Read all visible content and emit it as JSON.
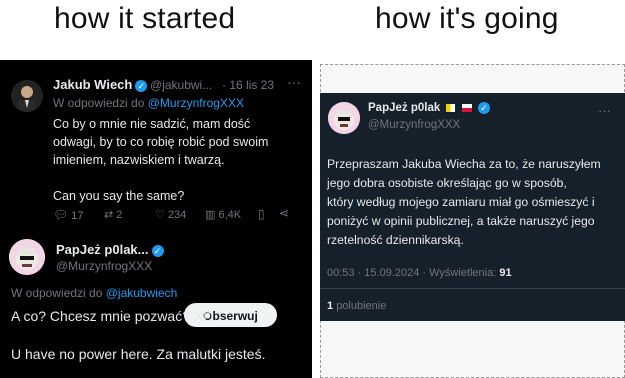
{
  "captions": {
    "left": "how it started",
    "right": "how it's going"
  },
  "left": {
    "tweet1": {
      "name": "Jakub Wiech",
      "handle": "@jakubwi...",
      "date": "· 16 lis 23",
      "more": "···",
      "reply_prefix": "W odpowiedzi do",
      "reply_to": "@MurzynfrogXXX",
      "text_lines": [
        "Co by o mnie nie sadzić, mam dość",
        "odwagi, by to co robię robić pod swoim",
        "imieniem, nazwiskiem i twarzą.",
        "",
        "Can you say the same?"
      ],
      "actions": {
        "replies": "17",
        "retweets": "2",
        "likes": "234",
        "views": "6,4K"
      }
    },
    "tweet2": {
      "name": "PapJeż p0lak...",
      "handle": "@MurzynfrogXXX",
      "follow_label": "Obserwuj",
      "reply_prefix": "W odpowiedzi do",
      "reply_to": "@jakubwiech",
      "line1": "A co? Chcesz mnie pozwać? XD",
      "line2": "U have no power here. Za malutki jesteś."
    }
  },
  "right": {
    "name": "PapJeż p0lak",
    "handle": "@MurzynfrogXXX",
    "text_lines": [
      "Przepraszam Jakuba Wiecha za to, że naruszyłem",
      "jego dobra osobiste określając go w sposób,",
      "który według mojego zamiaru miał go ośmieszyć i",
      "poniżyć w opinii publicznej, a także naruszyć jego",
      "rzetelność dziennikarską."
    ],
    "meta": "00:53 · 15.09.2024 · Wyświetlenia:",
    "views": "91",
    "likes_count": "1",
    "likes_label": "polubienie"
  },
  "colors": {
    "accent": "#1d9bf0",
    "dark_bg": "#000000",
    "dim_bg": "#15202b"
  }
}
